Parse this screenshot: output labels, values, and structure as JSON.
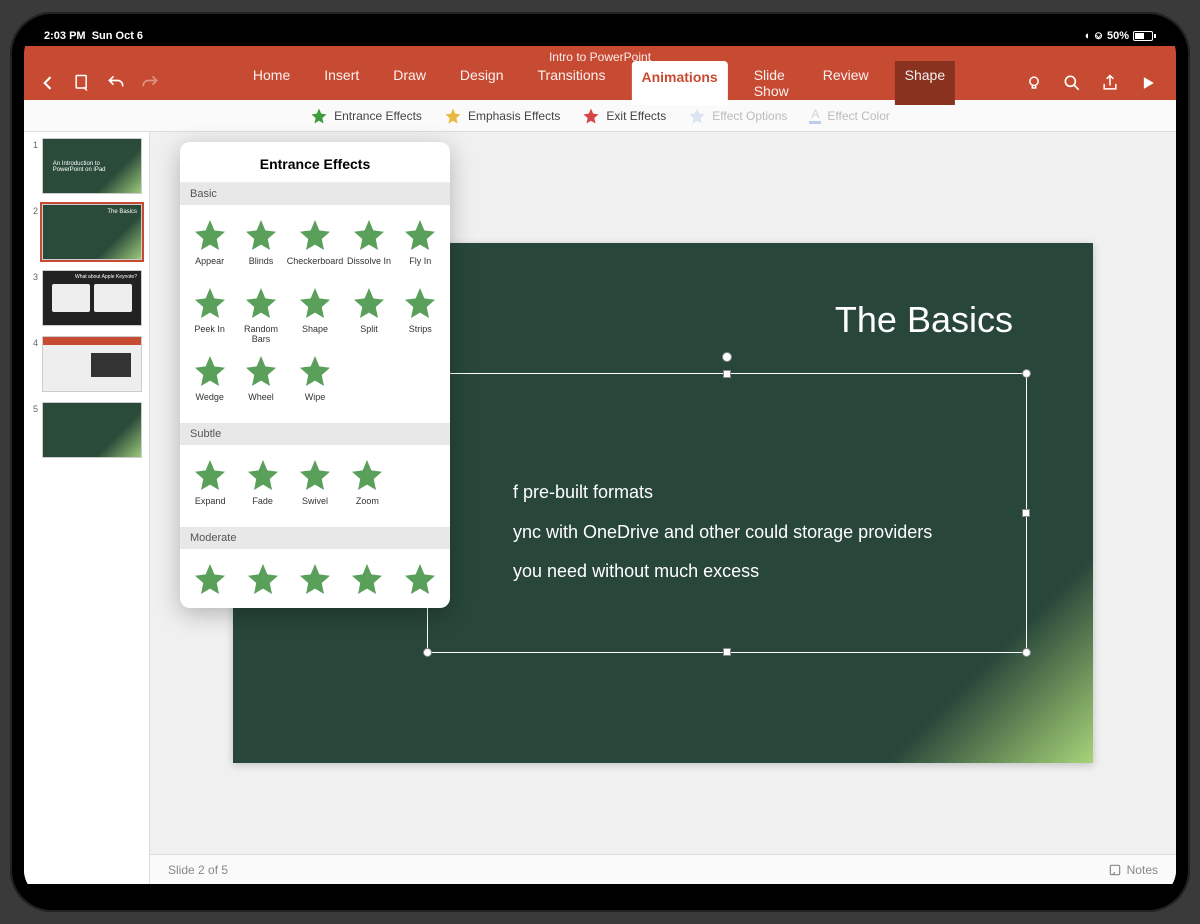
{
  "status": {
    "time": "2:03 PM",
    "date": "Sun Oct 6",
    "battery": "50%"
  },
  "doc_title": "Intro to PowerPoint",
  "tabs": {
    "home": "Home",
    "insert": "Insert",
    "draw": "Draw",
    "design": "Design",
    "transitions": "Transitions",
    "animations": "Animations",
    "slideshow": "Slide Show",
    "review": "Review",
    "shape": "Shape"
  },
  "ribbon": {
    "entrance": "Entrance Effects",
    "emphasis": "Emphasis Effects",
    "exit": "Exit Effects",
    "options": "Effect Options",
    "color": "Effect Color"
  },
  "thumbs": [
    {
      "n": "1",
      "title": "An Introduction to PowerPoint on iPad"
    },
    {
      "n": "2",
      "title": "The Basics"
    },
    {
      "n": "3",
      "title": "What about Apple Keynote?"
    },
    {
      "n": "4",
      "title": ""
    },
    {
      "n": "5",
      "title": ""
    }
  ],
  "slide": {
    "title": "The Basics",
    "bullets_visible": [
      "f pre-built formats",
      "ync with OneDrive and other could storage providers",
      "you need without much excess"
    ]
  },
  "popover": {
    "title": "Entrance Effects",
    "sections": [
      {
        "name": "Basic",
        "effects": [
          "Appear",
          "Blinds",
          "Checkerboard",
          "Dissolve In",
          "Fly In",
          "Peek In",
          "Random Bars",
          "Shape",
          "Split",
          "Strips",
          "Wedge",
          "Wheel",
          "Wipe"
        ]
      },
      {
        "name": "Subtle",
        "effects": [
          "Expand",
          "Fade",
          "Swivel",
          "Zoom"
        ]
      },
      {
        "name": "Moderate",
        "effects": [
          "",
          "",
          "",
          "",
          ""
        ]
      }
    ]
  },
  "footer": {
    "slide_pos": "Slide 2 of 5",
    "notes": "Notes"
  }
}
